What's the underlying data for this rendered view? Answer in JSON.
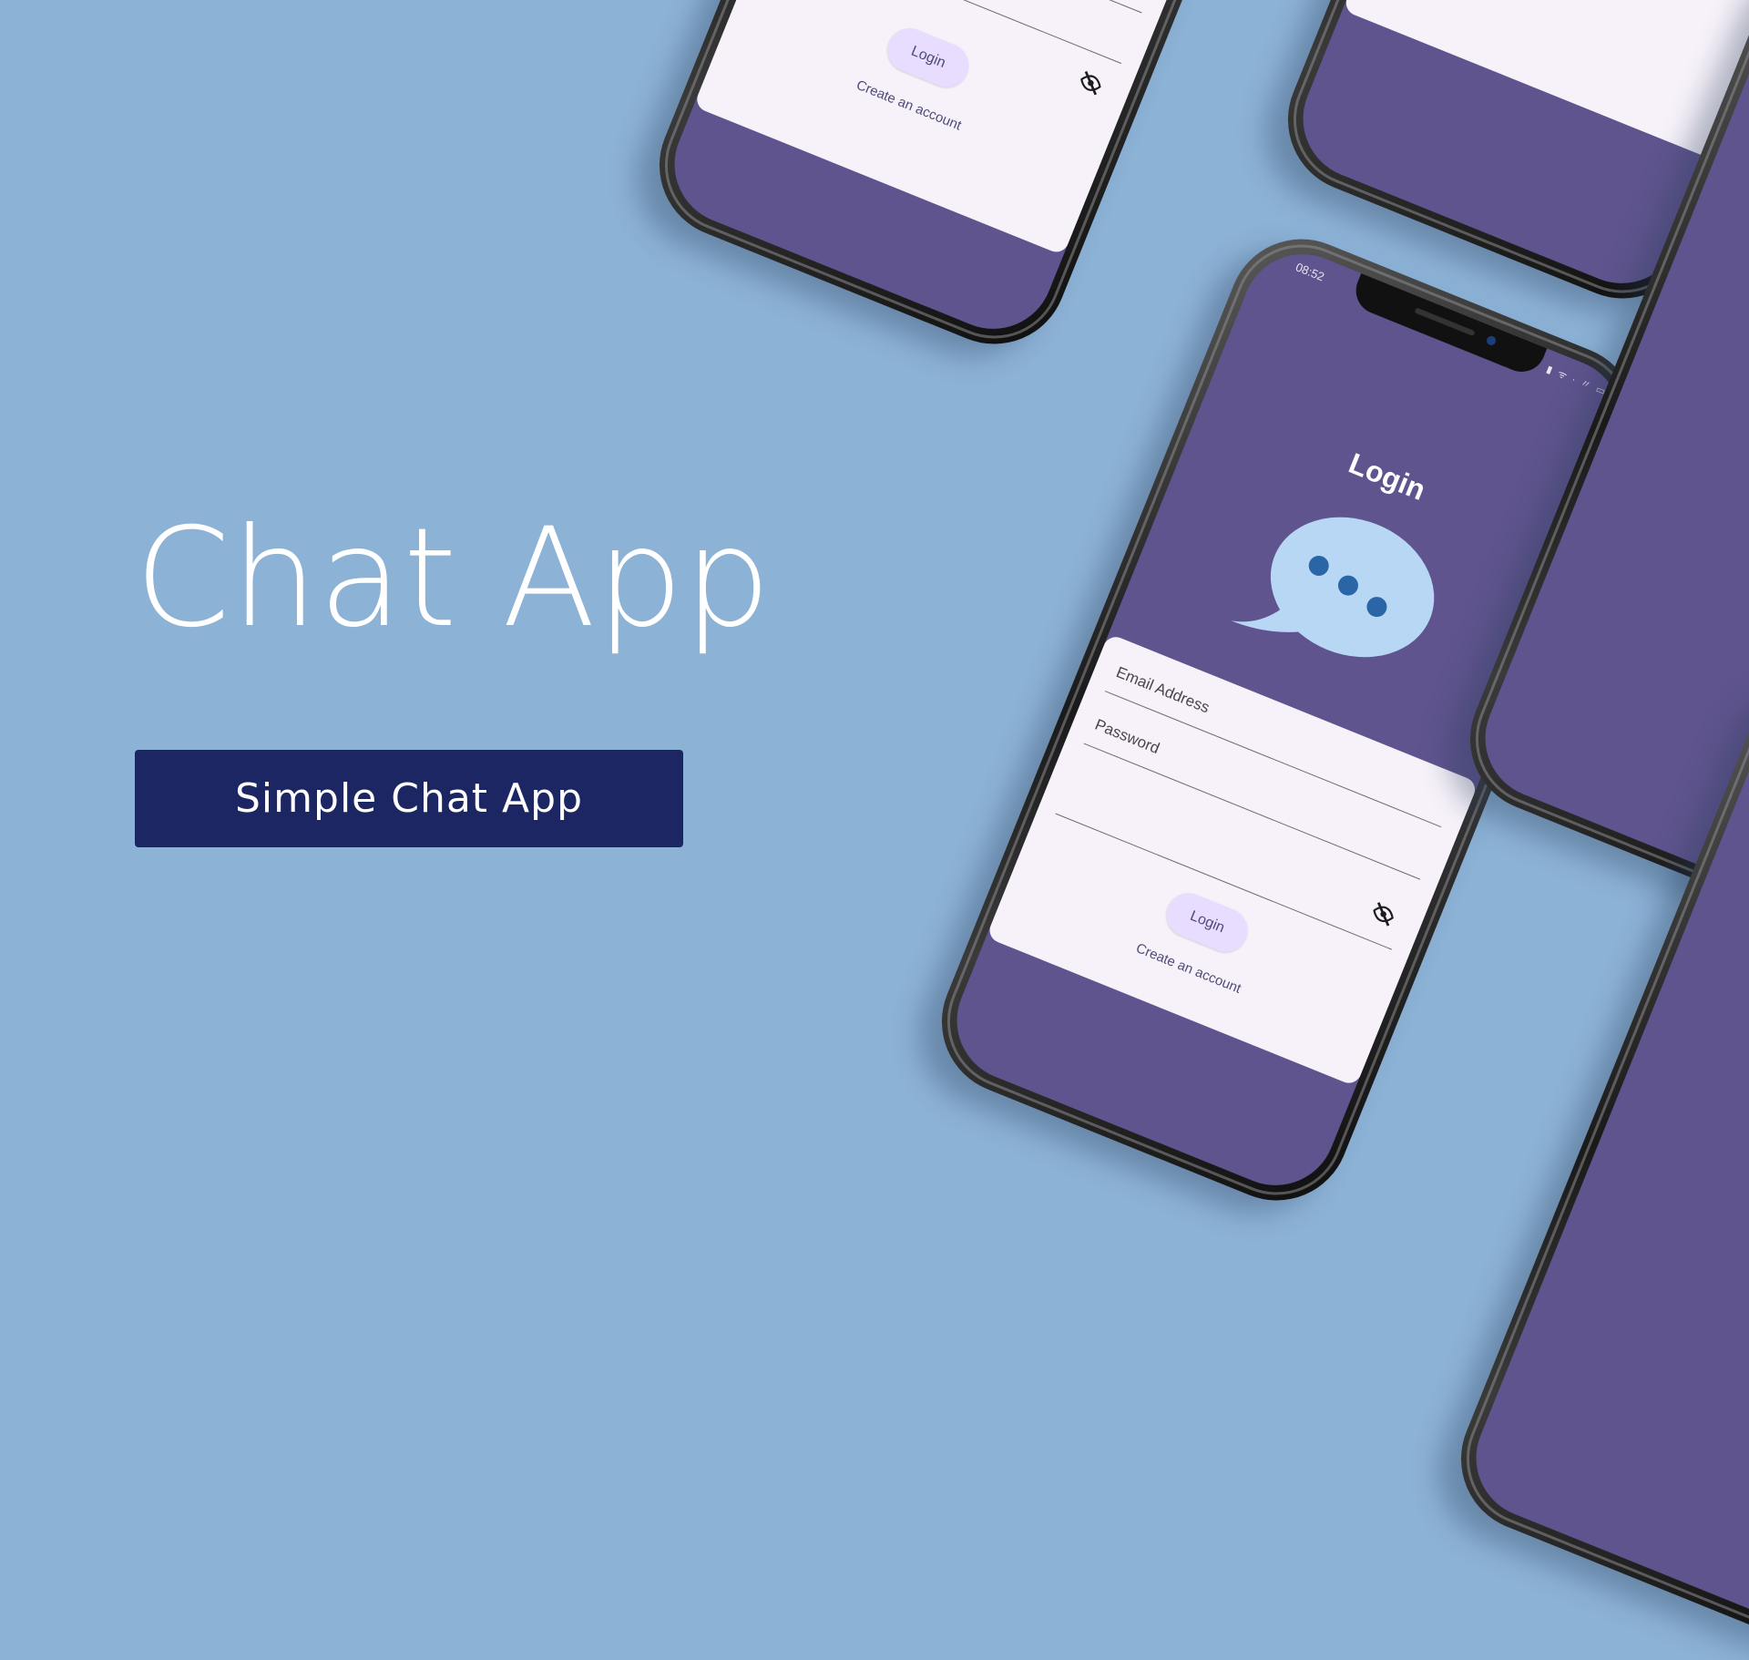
{
  "headline": "Chat App",
  "subtitle_button": "Simple Chat App",
  "colors": {
    "background": "#8cb2d6",
    "subtitle_button": "#1c2663",
    "screen": "#5f548e",
    "card": "#f7f2fa",
    "bubble": "#b7d7f4",
    "bubble_dots": "#2a66a6"
  },
  "phone": {
    "status_time": "08:52",
    "status_icons": "▮ ᯤ ∙ 〃 ▭",
    "screen_title": "Login",
    "email_label": "Email Address",
    "password_label": "Password",
    "login_button": "Login",
    "create_account": "Create an account"
  }
}
